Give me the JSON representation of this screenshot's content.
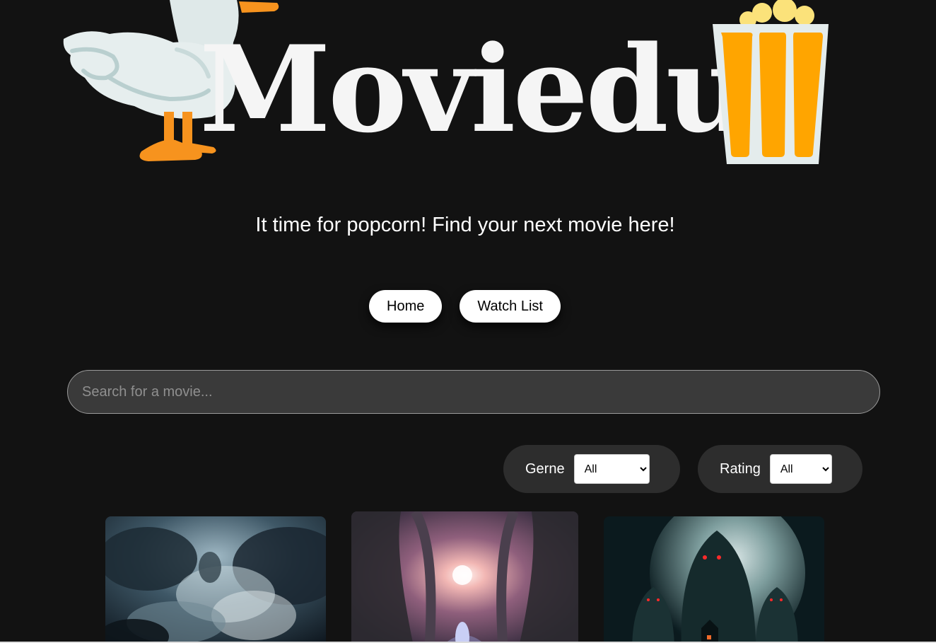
{
  "header": {
    "logo_text": "Moviedux",
    "duck_icon": "duck-icon",
    "popcorn_icon": "popcorn-icon"
  },
  "tagline": "It time for popcorn! Find your next movie here!",
  "nav": {
    "home_label": "Home",
    "watchlist_label": "Watch List"
  },
  "search": {
    "placeholder": "Search for a movie...",
    "value": ""
  },
  "filters": {
    "genre": {
      "label": "Gerne",
      "selected": "All"
    },
    "rating": {
      "label": "Rating",
      "selected": "All"
    }
  },
  "movies": [
    {
      "poster": "stormy-clouds-face-poster"
    },
    {
      "poster": "glowing-forest-path-poster"
    },
    {
      "poster": "full-moon-ghosts-poster"
    }
  ],
  "colors": {
    "background": "#121212",
    "search_bg": "#3a3a3a",
    "filter_bg": "#2d2d2d",
    "duck_orange": "#f7931e",
    "popcorn_orange": "#ffa500",
    "popcorn_yellow": "#fbe27a"
  }
}
